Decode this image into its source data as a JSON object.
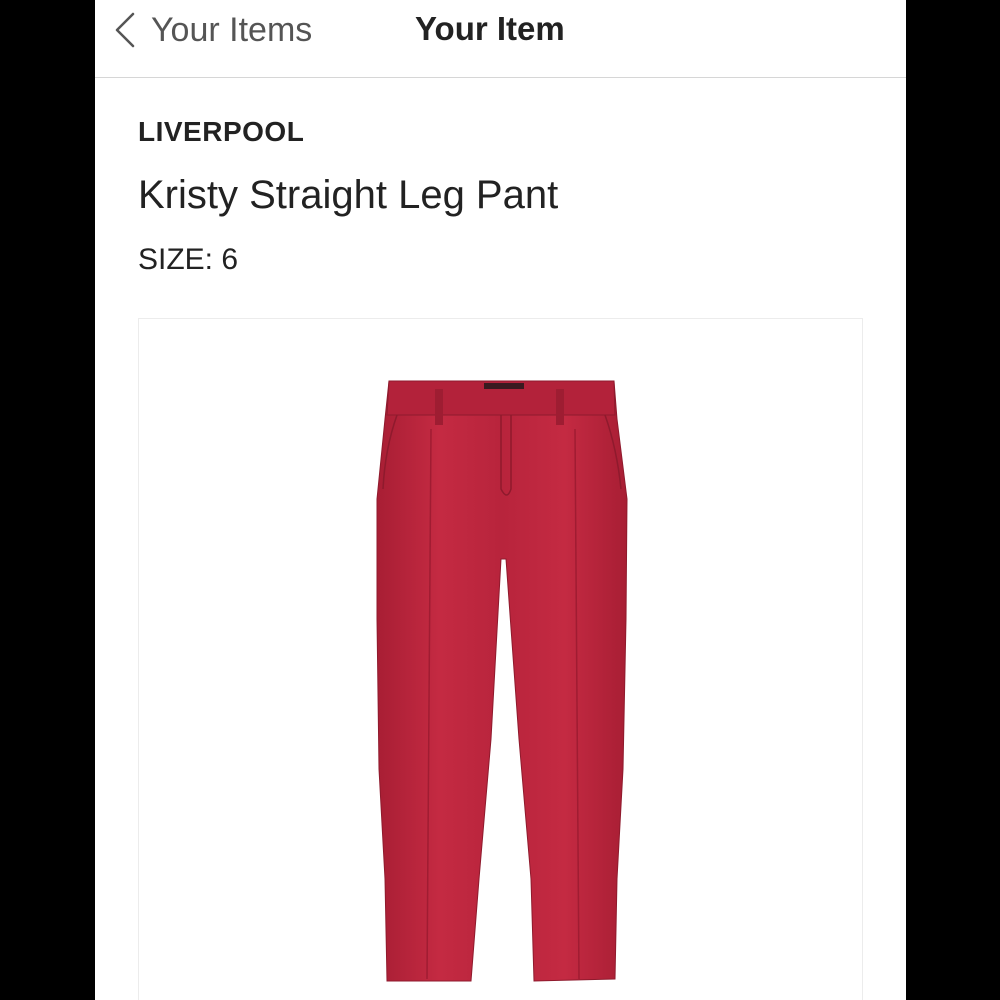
{
  "nav": {
    "back_label": "Your Items",
    "title": "Your Item"
  },
  "product": {
    "brand": "LIVERPOOL",
    "name": "Kristy Straight Leg Pant",
    "size_label": "SIZE:",
    "size_value": "6",
    "image_icon": "pants-image",
    "color": "#b8243c"
  }
}
